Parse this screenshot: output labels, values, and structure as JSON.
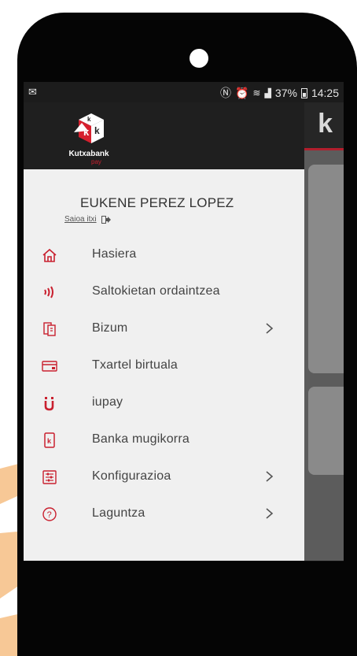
{
  "status_bar": {
    "left_icon": "mail-icon",
    "right_icons": [
      "nfc-icon",
      "alarm-icon",
      "wifi-icon",
      "signal-icon"
    ],
    "battery": "37%",
    "time": "14:25"
  },
  "app_header": {
    "letter": "k"
  },
  "drawer": {
    "brand": {
      "name": "Kutxabank",
      "sub": "pay"
    },
    "user": {
      "name": "EUKENE PEREZ LOPEZ",
      "logout_label": "Saioa itxi"
    },
    "items": [
      {
        "label": "Hasiera",
        "icon": "home-icon",
        "has_submenu": false
      },
      {
        "label": "Saltokietan ordaintzea",
        "icon": "contactless-icon",
        "has_submenu": false
      },
      {
        "label": "Bizum",
        "icon": "bizum-icon",
        "has_submenu": true
      },
      {
        "label": "Txartel birtuala",
        "icon": "card-icon",
        "has_submenu": false
      },
      {
        "label": "iupay",
        "icon": "iupay-icon",
        "has_submenu": false
      },
      {
        "label": "Banka mugikorra",
        "icon": "mobile-banking-icon",
        "has_submenu": false
      },
      {
        "label": "Konfigurazioa",
        "icon": "settings-icon",
        "has_submenu": true
      },
      {
        "label": "Laguntza",
        "icon": "help-icon",
        "has_submenu": true
      }
    ]
  },
  "colors": {
    "accent": "#c9202f",
    "drawer_bg": "#f0f0f0",
    "header_bg": "#1f1f1f",
    "hand": "#f7c896"
  }
}
